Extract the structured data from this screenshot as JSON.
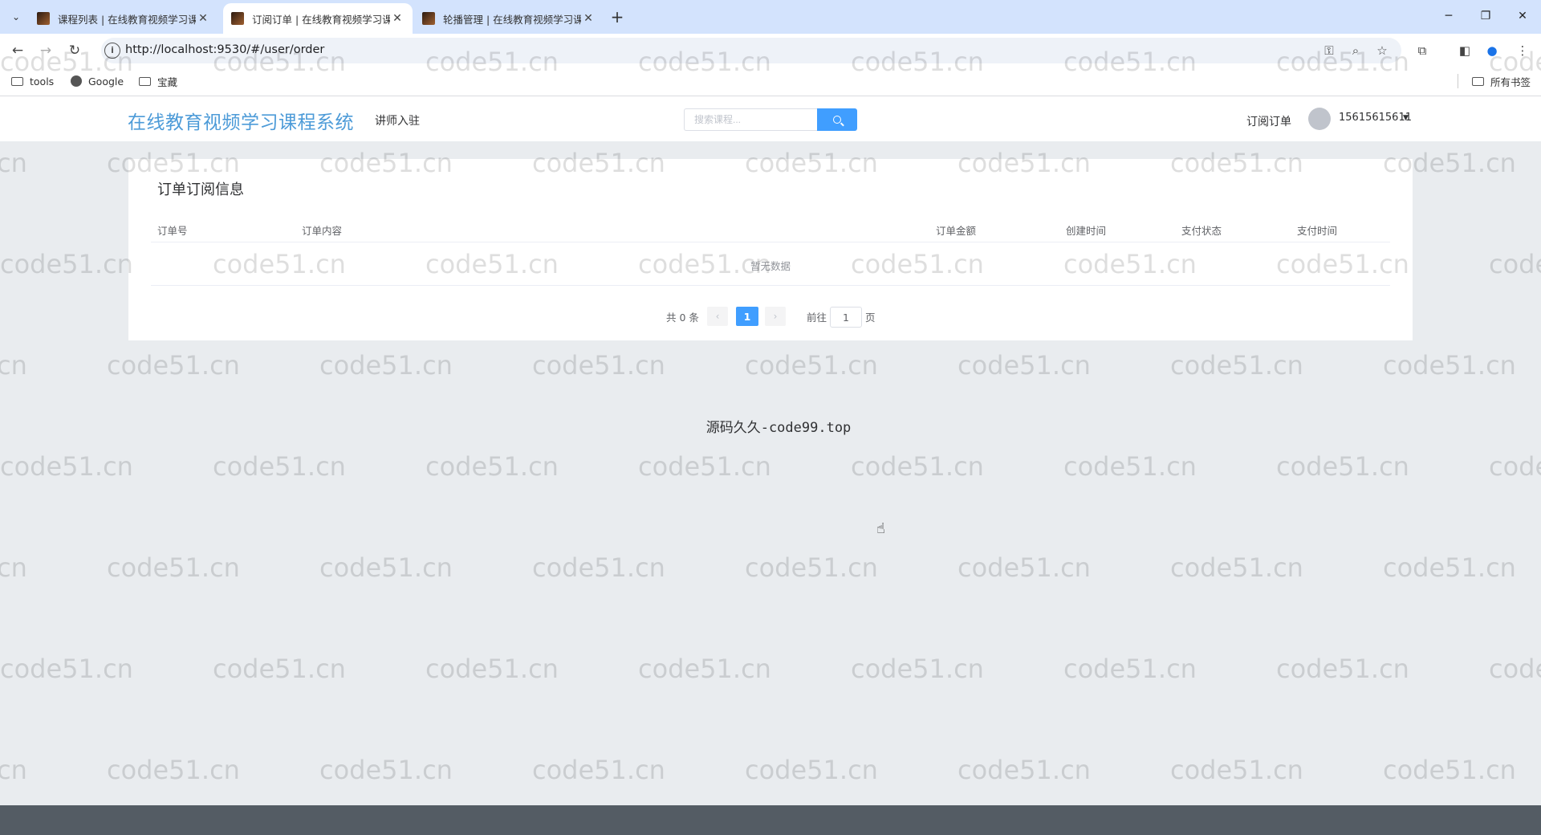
{
  "browser": {
    "tabs": [
      {
        "title": "课程列表 | 在线教育视频学习课"
      },
      {
        "title": "订阅订单 | 在线教育视频学习课"
      },
      {
        "title": "轮播管理 | 在线教育视频学习课"
      }
    ],
    "url": "http://localhost:9530/#/user/order",
    "bookmarks": [
      {
        "label": "tools"
      },
      {
        "label": "Google"
      },
      {
        "label": "宝藏"
      }
    ],
    "all_bookmarks": "所有书签"
  },
  "header": {
    "logo": "在线教育视频学习课程系统",
    "teacher_link": "讲师入驻",
    "search_placeholder": "搜索课程...",
    "order_link": "订阅订单",
    "username": "15615615611"
  },
  "card": {
    "title": "订单订阅信息",
    "columns": [
      "订单号",
      "订单内容",
      "订单金额",
      "创建时间",
      "支付状态",
      "支付时间"
    ],
    "empty_text": "暂无数据"
  },
  "pagination": {
    "total_text": "共 0 条",
    "current_page": "1",
    "goto_label": "前往",
    "goto_value": "1",
    "page_suffix": "页"
  },
  "source_text": "源码久久-code99.top",
  "watermark": "code51.cn"
}
